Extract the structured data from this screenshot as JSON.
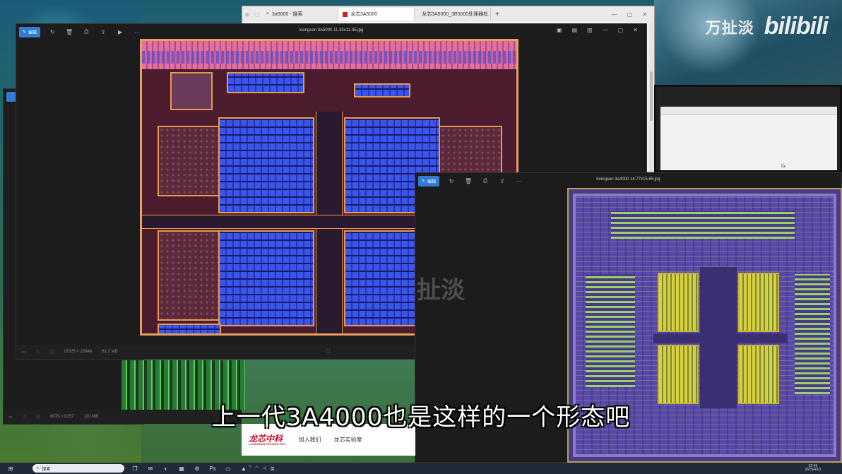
{
  "browser": {
    "tabs": [
      {
        "label": "3a5000 - 搜索",
        "active": false
      },
      {
        "label": "龙芯3A5000",
        "active": true
      },
      {
        "label": "龙芯3A5000_3B5000处理器松...",
        "active": false
      }
    ],
    "new_tab": "+"
  },
  "viewer1": {
    "edit_label": "编辑",
    "title": "loongson 3A5000 11.33x12.35.jpg",
    "status": {
      "dimensions": "19325 × 20946",
      "size": "61.2 MB"
    }
  },
  "viewer2": {
    "edit_label": "编辑",
    "title": "loongson 3a4000 14.77x15.65.jpg"
  },
  "viewer3": {
    "status": {
      "dimensions": "8079 × 8157",
      "size": "120 MB"
    }
  },
  "mini_window": {
    "address": "7a"
  },
  "watermark": {
    "name": "万扯淡",
    "logo": "bilibili",
    "faint": "扯淡"
  },
  "banner": {
    "brand": "龙芯中科",
    "brand_sub": "LOONGSON TECHNOLOGY",
    "link1": "加入我们",
    "link2": "龙芯实验室"
  },
  "subtitle": "上一代3A4000也是这样的一个形态吧",
  "taskbar": {
    "search_placeholder": "搜索",
    "time": "22:49",
    "date": "2025/4/10",
    "lang": "英"
  }
}
